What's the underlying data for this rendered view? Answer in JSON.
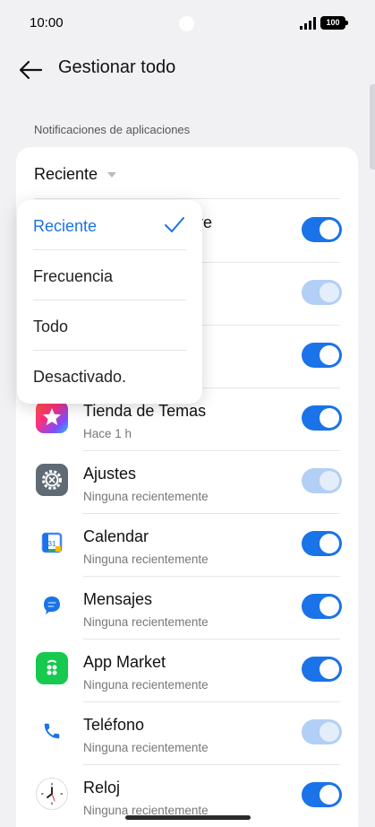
{
  "status_bar": {
    "time": "10:00",
    "battery": "100"
  },
  "header": {
    "title": "Gestionar todo"
  },
  "section": {
    "label": "Notificaciones de aplicaciones"
  },
  "sort": {
    "current": "Reciente",
    "options": [
      "Reciente",
      "Frecuencia",
      "Todo",
      "Desactivado."
    ],
    "selected_index": 0
  },
  "hidden_row_partial_text": "re",
  "apps": [
    {
      "name": "Tienda de Temas",
      "sub": "Hace 1 h",
      "enabled": true,
      "toggle_disabled": false,
      "icon": "theme-store-icon"
    },
    {
      "name": "Ajustes",
      "sub": "Ninguna recientemente",
      "enabled": true,
      "toggle_disabled": true,
      "icon": "settings-gear-icon"
    },
    {
      "name": "Calendar",
      "sub": "Ninguna recientemente",
      "enabled": true,
      "toggle_disabled": false,
      "icon": "calendar-icon"
    },
    {
      "name": "Mensajes",
      "sub": "Ninguna recientemente",
      "enabled": true,
      "toggle_disabled": false,
      "icon": "messages-icon"
    },
    {
      "name": "App Market",
      "sub": "Ninguna recientemente",
      "enabled": true,
      "toggle_disabled": false,
      "icon": "app-market-icon"
    },
    {
      "name": "Teléfono",
      "sub": "Ninguna recientemente",
      "enabled": true,
      "toggle_disabled": true,
      "icon": "phone-icon"
    },
    {
      "name": "Reloj",
      "sub": "Ninguna recientemente",
      "enabled": true,
      "toggle_disabled": false,
      "icon": "clock-icon"
    }
  ],
  "colors": {
    "accent": "#1a73e8",
    "accent_disabled": "#b2cff5",
    "background": "#f1f1f4"
  }
}
